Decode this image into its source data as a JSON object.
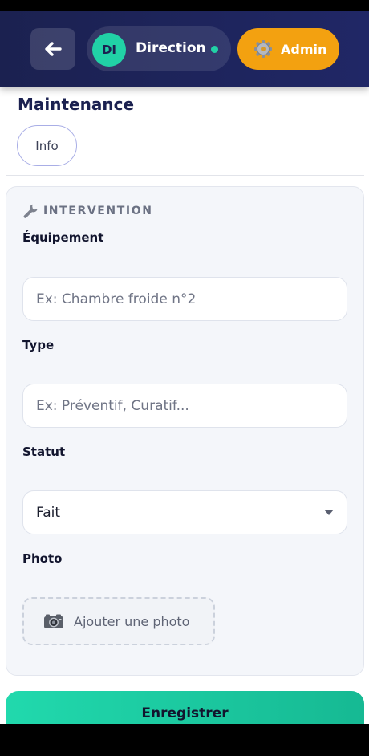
{
  "header": {
    "user_initials": "DI",
    "user_name": "Direction",
    "admin_label": "Admin"
  },
  "page": {
    "title": "Maintenance",
    "tabs": [
      {
        "label": "Info"
      }
    ]
  },
  "form": {
    "section_title": "INTERVENTION",
    "section_icon": "wrench-icon",
    "fields": {
      "equipment": {
        "label": "Équipement",
        "placeholder": "Ex: Chambre froide n°2"
      },
      "type": {
        "label": "Type",
        "placeholder": "Ex: Préventif, Curatif..."
      },
      "status": {
        "label": "Statut",
        "value": "Fait"
      },
      "photo": {
        "label": "Photo",
        "button_label": "Ajouter une photo",
        "icon": "camera-icon"
      }
    },
    "submit_label": "Enregistrer"
  },
  "colors": {
    "header_bg": "#1b2150",
    "accent_green": "#21d1a6",
    "admin_orange": "#f3a110"
  }
}
